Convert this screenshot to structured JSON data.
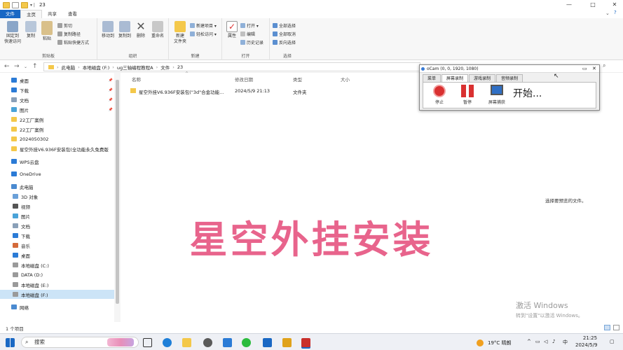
{
  "titlebar": {
    "path_label": "23",
    "controls": [
      "—",
      "□",
      "✕"
    ]
  },
  "ribbon_tabs": [
    "文件",
    "主页",
    "共享",
    "查看"
  ],
  "ribbon": {
    "clipboard": {
      "label": "剪贴板",
      "pin": "固定到\n快速访问",
      "copy": "复制",
      "paste": "粘贴",
      "cut": "剪切",
      "copy_path": "复制路径",
      "paste_shortcut": "粘贴快捷方式"
    },
    "organize": {
      "label": "组织",
      "move_to": "移动到",
      "copy_to": "复制到",
      "delete": "删除",
      "rename": "重命名"
    },
    "new": {
      "label": "新建",
      "new_folder": "新建\n文件夹",
      "new_item": "新建项目 ▾",
      "easy_access": "轻松访问 ▾"
    },
    "open": {
      "label": "打开",
      "properties": "属性",
      "open": "打开 ▾",
      "edit": "编辑",
      "history": "历史记录"
    },
    "select": {
      "label": "选择",
      "select_all": "全部选择",
      "select_none": "全部取消",
      "invert": "反向选择"
    }
  },
  "address": {
    "crumbs": [
      "此电脑",
      "本地磁盘 (F:)",
      "ug三轴编程教程A",
      "文件",
      "23"
    ]
  },
  "nav": {
    "items": [
      {
        "label": "桌面",
        "pinned": true
      },
      {
        "label": "下载",
        "pinned": true
      },
      {
        "label": "文档",
        "pinned": true
      },
      {
        "label": "图片",
        "pinned": true
      },
      {
        "label": "22工厂案例",
        "pinned": false
      },
      {
        "label": "22工厂案例",
        "pinned": false
      },
      {
        "label": "2024050302",
        "pinned": false
      },
      {
        "label": "星空外挂V6.936F安装包(全功能永久免费版",
        "pinned": false
      },
      {
        "label": "WPS云盘",
        "pinned": false
      },
      {
        "label": "OneDrive",
        "pinned": false
      },
      {
        "label": "此电脑",
        "pinned": false
      },
      {
        "label": "3D 对象",
        "pinned": false
      },
      {
        "label": "视频",
        "pinned": false
      },
      {
        "label": "图片",
        "pinned": false
      },
      {
        "label": "文档",
        "pinned": false
      },
      {
        "label": "下载",
        "pinned": false
      },
      {
        "label": "音乐",
        "pinned": false
      },
      {
        "label": "桌面",
        "pinned": false
      },
      {
        "label": "本地磁盘 (C:)",
        "pinned": false
      },
      {
        "label": "DATA (D:)",
        "pinned": false
      },
      {
        "label": "本地磁盘 (E:)",
        "pinned": false
      },
      {
        "label": "本地磁盘 (F:)",
        "pinned": false
      },
      {
        "label": "网络",
        "pinned": false
      }
    ]
  },
  "list": {
    "headers": {
      "name": "名称",
      "date": "修改日期",
      "type": "类型",
      "size": "大小"
    },
    "rows": [
      {
        "name": "星空外挂V6.936F安装包(\"3d\"合金功能...",
        "date": "2024/5/9 21:13",
        "type": "文件夹",
        "size": ""
      }
    ]
  },
  "preview_message": "选择要预览的文件。",
  "caption": "星空外挂安装",
  "watermark": {
    "line1": "激活 Windows",
    "line2": "转到\"设置\"以激活 Windows。"
  },
  "status": {
    "count": "1 个项目"
  },
  "ocam": {
    "title": "oCam (0, 0, 1920, 1080)",
    "tabs": [
      "菜单",
      "屏幕录制",
      "游戏录制",
      "音频录制"
    ],
    "buttons": {
      "stop": "停止",
      "pause": "暂停",
      "capture": "屏幕捕获"
    },
    "status": "开始..."
  },
  "taskbar": {
    "search": "搜索",
    "weather": "19°C 晴朗",
    "ime": "中",
    "time": "21:25",
    "date": "2024/5/9"
  },
  "colors": {
    "accent": "#1a68c4",
    "caption": "#e8648c",
    "selected": "#cce4f7",
    "ocam_stop": "#d93030"
  }
}
